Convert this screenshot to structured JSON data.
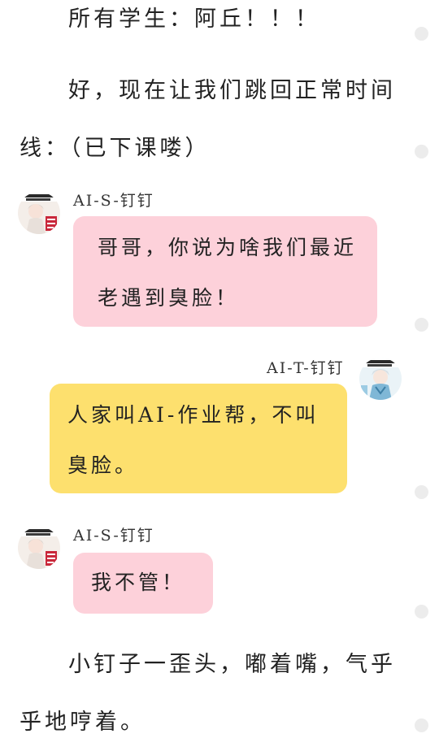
{
  "narration": [
    "所有学生：阿丘！！！",
    "好，现在让我们跳回正常时间线：（已下课喽）",
    "小钉子一歪头，嘟着嘴，气乎乎地哼着。"
  ],
  "messages": [
    {
      "sender": "AI-S-钉钉",
      "side": "left",
      "text": "哥哥，你说为啥我们最近老遇到臭脸！",
      "bubble_color": "#fdd1da"
    },
    {
      "sender": "AI-T-钉钉",
      "side": "right",
      "text": "人家叫AI-作业帮，不叫臭脸。",
      "bubble_color": "#fde06e"
    },
    {
      "sender": "AI-S-钉钉",
      "side": "left",
      "text": "我不管！",
      "bubble_color": "#fdd1da"
    }
  ],
  "avatars": {
    "left": "girl-magazine-avatar-icon",
    "right": "boy-magazine-avatar-icon"
  },
  "colors": {
    "pink_bubble": "#fdd1da",
    "yellow_bubble": "#fde06e",
    "side_dot": "#ececec",
    "text": "#222222"
  }
}
